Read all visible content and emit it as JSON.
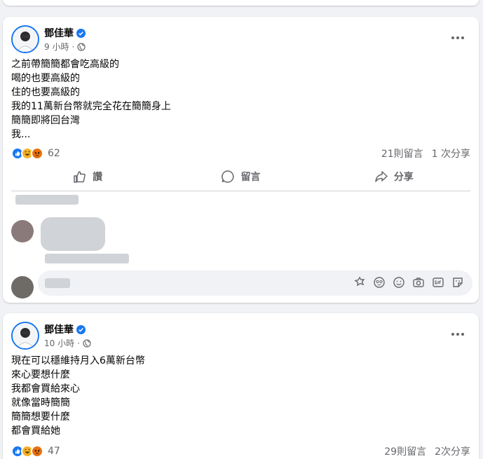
{
  "posts": [
    {
      "author": "鄧佳華",
      "time": "9 小時",
      "separator": "·",
      "lines": [
        "之前帶簡簡都會吃高級的",
        "喝的也要高級的",
        "住的也要高級的",
        "我的11萬新台幣就完全花在簡簡身上",
        "簡簡即將回台灣",
        "我..."
      ],
      "reaction_count": "62",
      "comments": "21則留言",
      "shares": "1 次分享",
      "actions": {
        "like": "讚",
        "comment": "留言",
        "share": "分享"
      }
    },
    {
      "author": "鄧佳華",
      "time": "10 小時",
      "separator": "·",
      "lines": [
        "現在可以穩維持月入6萬新台幣",
        "來心要想什麼",
        "我都會買給來心",
        "就像當時簡簡",
        "簡簡想要什麼",
        "都會買給她"
      ],
      "reaction_count": "47",
      "comments": "29則留言",
      "shares": "2次分享"
    }
  ],
  "icons": {
    "verified": "verified-badge-icon",
    "privacy": "globe-icon",
    "more": "more-options-icon",
    "reactions": [
      "like-reaction-icon",
      "haha-reaction-icon",
      "angry-reaction-icon"
    ],
    "composer": [
      "avatar-sticker-icon",
      "emoji-face-icon",
      "smiley-icon",
      "camera-icon",
      "gif-icon",
      "sticker-icon"
    ]
  },
  "colors": {
    "accent": "#1877f2",
    "muted": "#65676b",
    "background": "#f0f2f5",
    "angry": "#e9710f",
    "haha": "#f7b125"
  }
}
